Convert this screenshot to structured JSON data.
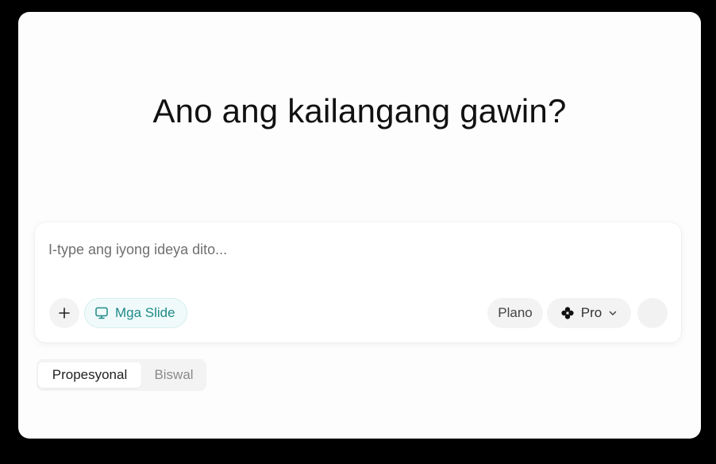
{
  "main": {
    "headline": "Ano ang kailangang gawin?"
  },
  "composer": {
    "placeholder": "I-type ang iyong ideya dito...",
    "value": "",
    "add_icon": "plus-icon",
    "slides_chip": {
      "label": "Mga Slide",
      "icon": "presentation-monitor-icon"
    },
    "plan_label": "Plano",
    "pro": {
      "label": "Pro",
      "icon": "flower-icon",
      "chevron": "chevron-down-icon"
    },
    "send_icon": "send-button"
  },
  "tabs": [
    {
      "label": "Propesyonal",
      "active": true
    },
    {
      "label": "Biswal",
      "active": false
    }
  ],
  "colors": {
    "background": "#000000",
    "window": "#fdfdfd",
    "accent_teal": "#1f8a88",
    "chip_bg": "#f0fafa"
  }
}
